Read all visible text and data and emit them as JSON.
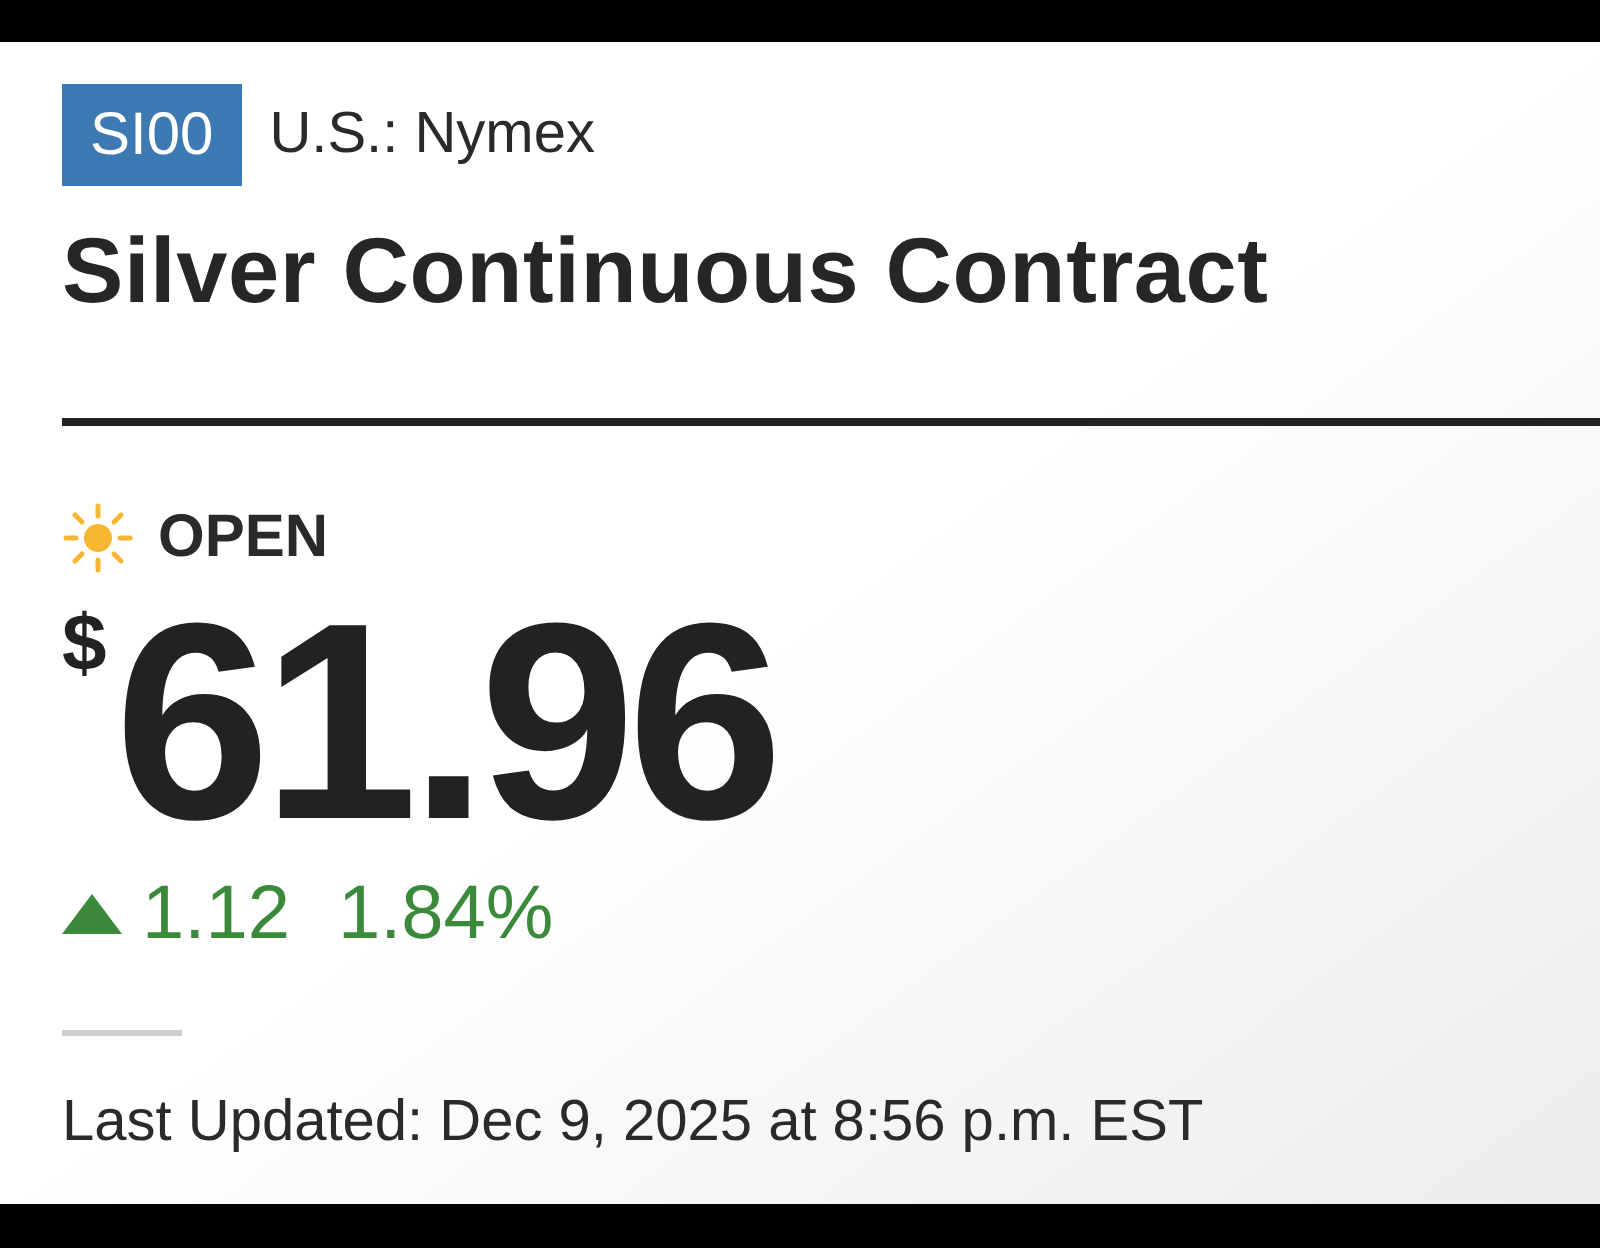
{
  "symbol": "SI00",
  "exchange": "U.S.: Nymex",
  "title": "Silver Continuous Contract",
  "market_status": {
    "kind": "open",
    "label": "OPEN"
  },
  "price": {
    "currency": "$",
    "value": "61.96"
  },
  "change": {
    "kind": "up",
    "points": "1.12",
    "percent": "1.84%"
  },
  "last_updated": "Last Updated: Dec 9, 2025 at 8:56 p.m. EST"
}
